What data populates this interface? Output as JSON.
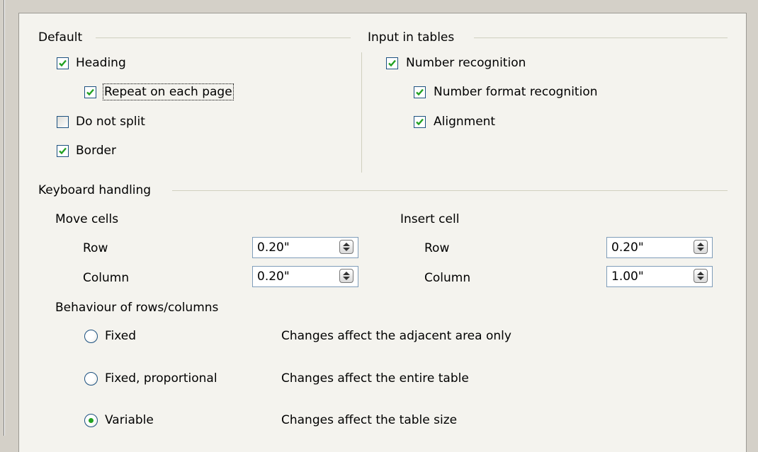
{
  "sections": {
    "default": "Default",
    "input_in_tables": "Input in tables",
    "keyboard_handling": "Keyboard handling"
  },
  "default_options": {
    "heading": {
      "label": "Heading",
      "checked": true
    },
    "repeat_on_each_page": {
      "label": "Repeat on each page",
      "checked": true
    },
    "do_not_split": {
      "label": "Do not split",
      "checked": false
    },
    "border": {
      "label": "Border",
      "checked": true
    }
  },
  "input_options": {
    "number_recognition": {
      "label": "Number recognition",
      "checked": true
    },
    "number_format_recognition": {
      "label": "Number format recognition",
      "checked": true
    },
    "alignment": {
      "label": "Alignment",
      "checked": true
    }
  },
  "move_cells": {
    "title": "Move cells",
    "row_label": "Row",
    "row_value": "0.20\"",
    "column_label": "Column",
    "column_value": "0.20\""
  },
  "insert_cell": {
    "title": "Insert cell",
    "row_label": "Row",
    "row_value": "0.20\"",
    "column_label": "Column",
    "column_value": "1.00\""
  },
  "behaviour": {
    "title": "Behaviour of rows/columns",
    "options": [
      {
        "label": "Fixed",
        "description": "Changes affect the adjacent area only",
        "selected": false
      },
      {
        "label": "Fixed, proportional",
        "description": "Changes affect the entire table",
        "selected": false
      },
      {
        "label": "Variable",
        "description": "Changes affect the table size",
        "selected": true
      }
    ]
  },
  "colors": {
    "panel": "#f4f3ee",
    "window": "#d4d0c8",
    "check": "#21a121",
    "control_border": "#1c5180"
  }
}
